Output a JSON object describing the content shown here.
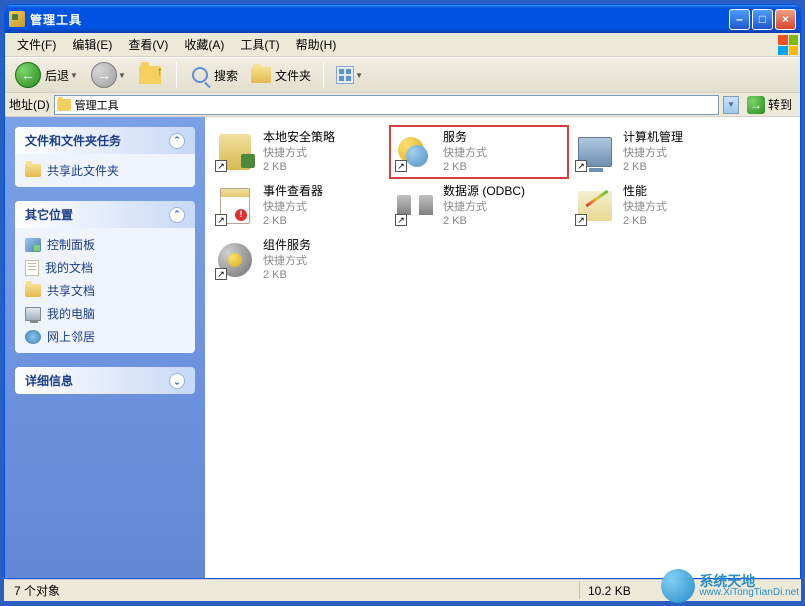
{
  "titlebar": {
    "title": "管理工具"
  },
  "menu": {
    "file": "文件(F)",
    "edit": "编辑(E)",
    "view": "查看(V)",
    "fav": "收藏(A)",
    "tools": "工具(T)",
    "help": "帮助(H)"
  },
  "toolbar": {
    "back": "后退",
    "search": "搜索",
    "folders": "文件夹"
  },
  "address": {
    "label": "地址(D)",
    "value": "管理工具",
    "go": "转到"
  },
  "sidebar": {
    "tasks": {
      "title": "文件和文件夹任务",
      "share": "共享此文件夹"
    },
    "places": {
      "title": "其它位置",
      "cp": "控制面板",
      "mydocs": "我的文档",
      "shared": "共享文档",
      "mycomp": "我的电脑",
      "network": "网上邻居"
    },
    "details": {
      "title": "详细信息"
    }
  },
  "files": {
    "type": "快捷方式",
    "size": "2 KB",
    "security": "本地安全策略",
    "services": "服务",
    "mgmt": "计算机管理",
    "event": "事件查看器",
    "odbc": "数据源 (ODBC)",
    "perf": "性能",
    "compsvc": "组件服务"
  },
  "status": {
    "count": "7 个对象",
    "size": "10.2 KB"
  },
  "watermark": {
    "cn": "系统天地",
    "url": "www.XiTongTianDi.net"
  }
}
